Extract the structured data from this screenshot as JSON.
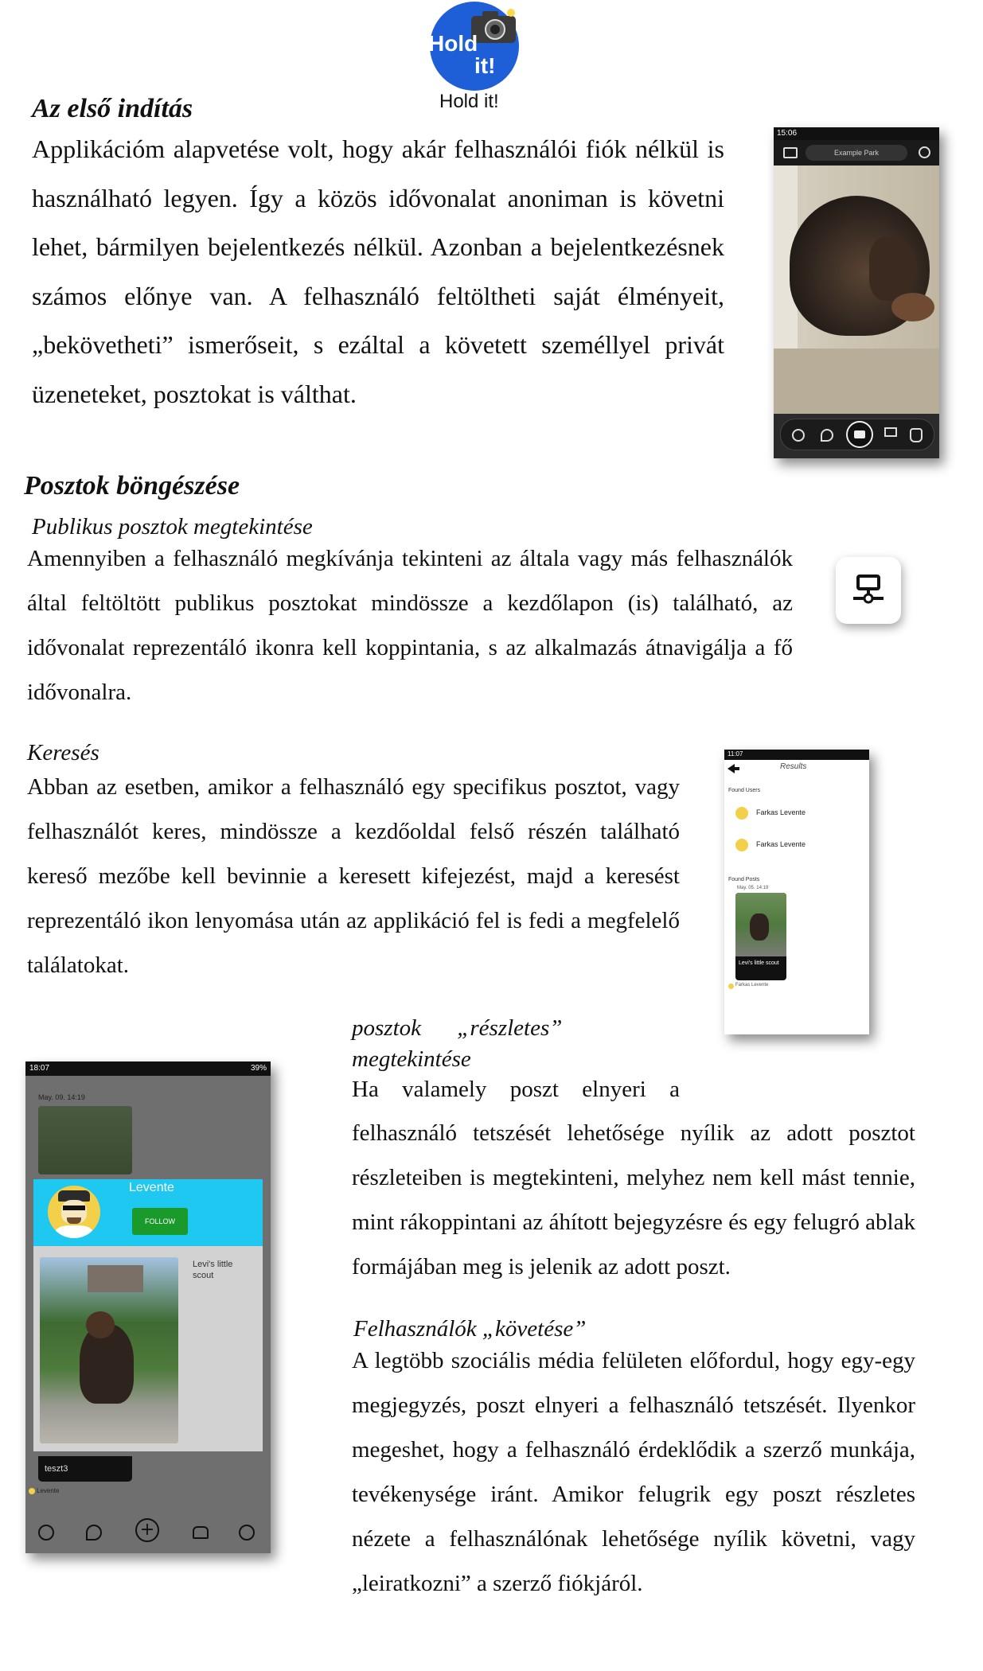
{
  "logo": {
    "line1": "Hold",
    "line2": "it!",
    "caption": "Hold it!"
  },
  "section1": {
    "heading": "Az első indítás",
    "body": "Applikációm alapvetése volt, hogy akár felhasználói fiók nélkül is használható legyen. Így a közös idővonalat anoniman is követni lehet, bármilyen bejelentkezés nélkül. Azonban a bejelentkezésnek számos előnye van. A felhasználó feltöltheti saját élményeit, „bekövetheti” ismerőseit, s ezáltal a követett személlyel privát üzeneteket, posztokat is válthat."
  },
  "camera_screen": {
    "status_time": "15:06",
    "location_label": "Example Park"
  },
  "section2": {
    "heading": "Posztok böngészése",
    "sub_public": "Publikus posztok megtekintése",
    "body_public": "Amennyiben a felhasználó megkívánja tekinteni az általa vagy más felhasználók által feltöltött publikus posztokat mindössze a kezdőlapon (is) található, az idővonalat reprezentáló ikonra kell koppintania, s az alkalmazás átnavigálja a fő idővonalra.",
    "sub_search": "Keresés",
    "body_search": "Abban az esetben, amikor a felhasználó egy specifikus posztot, vagy felhasználót keres, mindössze a kezdőoldal felső részén található kereső mezőbe kell bevinnie a keresett kifejezést, majd a keresést reprezentáló ikon lenyomása után az applikáció fel is fedi a megfelelő találatokat."
  },
  "results_screen": {
    "status_time": "11:07",
    "title": "Results",
    "found_users_label": "Found Users",
    "users": [
      "Farkas Levente",
      "Farkas Levente"
    ],
    "found_posts_label": "Found Posts",
    "post_date": "May. 05. 14:19",
    "post_caption": "Levi's little scout",
    "post_author": "Farkas Levente"
  },
  "detail_screen": {
    "status_time": "18:07",
    "status_battery": "39%",
    "date": "May. 09. 14:19",
    "username": "Levente",
    "follow_label": "FOLLOW",
    "caption": "Levi's little scout",
    "bottom_card": "teszt3",
    "bottom_author": "Levente"
  },
  "section3": {
    "sub_detail_line1": "posztok „részletes”",
    "sub_detail_line2": "megtekintése",
    "body_detail_first": "Ha valamely poszt elnyeri a",
    "body_detail_rest": "felhasználó tetszését lehetősége nyílik az adott posztot részleteiben is megtekinteni, melyhez nem kell mást tennie, mint rákoppintani az áhított bejegyzésre és egy felugró ablak formájában meg is jelenik az adott poszt.",
    "sub_follow": "Felhasználók „követése”",
    "body_follow": "A legtöbb szociális média felületen előfordul, hogy egy-egy megjegyzés, poszt elnyeri a felhasználó tetszését. Ilyenkor megeshet, hogy a felhasználó érdeklődik a szerző munkája, tevékenysége iránt. Amikor felugrik egy poszt részletes nézete a felhasználónak lehetősége nyílik követni, vagy „leiratkozni” a szerző fiókjáról."
  },
  "colors": {
    "logo_blue": "#1e5fd8",
    "cyan_header": "#1ec8f0",
    "follow_green": "#1a9a2a"
  }
}
